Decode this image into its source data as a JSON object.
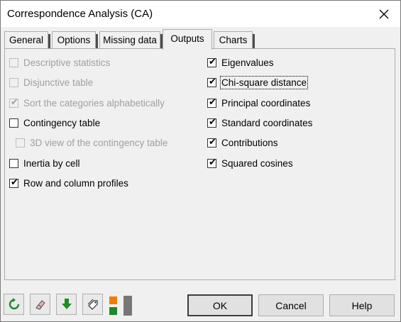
{
  "window": {
    "title": "Correspondence Analysis (CA)"
  },
  "tabs": [
    {
      "label": "General",
      "active": false
    },
    {
      "label": "Options",
      "active": false
    },
    {
      "label": "Missing data",
      "active": false
    },
    {
      "label": "Outputs",
      "active": true
    },
    {
      "label": "Charts",
      "active": false
    }
  ],
  "left_options": [
    {
      "label": "Descriptive statistics",
      "checked": false,
      "enabled": false
    },
    {
      "label": "Disjunctive table",
      "checked": false,
      "enabled": false
    },
    {
      "label": "Sort the categories alphabetically",
      "checked": true,
      "enabled": false
    },
    {
      "label": "Contingency table",
      "checked": false,
      "enabled": true
    },
    {
      "label": "3D view of the contingency table",
      "checked": false,
      "enabled": false
    },
    {
      "label": "Inertia by cell",
      "checked": false,
      "enabled": true
    },
    {
      "label": "Row and column profiles",
      "checked": true,
      "enabled": true
    }
  ],
  "right_options": [
    {
      "label": "Eigenvalues",
      "checked": true,
      "enabled": true
    },
    {
      "label": "Chi-square distance",
      "checked": true,
      "enabled": true
    },
    {
      "label": "Principal coordinates",
      "checked": true,
      "enabled": true
    },
    {
      "label": "Standard coordinates",
      "checked": true,
      "enabled": true
    },
    {
      "label": "Contributions",
      "checked": true,
      "enabled": true
    },
    {
      "label": "Squared cosines",
      "checked": true,
      "enabled": true
    }
  ],
  "toolbar_icons": [
    "reset-icon",
    "eraser-icon",
    "download-arrow-icon",
    "tag-icon",
    "layout-toggle-icon"
  ],
  "buttons": {
    "ok": "OK",
    "cancel": "Cancel",
    "help": "Help"
  },
  "colors": {
    "reset_green": "#1a8a2a",
    "arrow_green": "#1e8c1e",
    "orange": "#f07d00"
  }
}
